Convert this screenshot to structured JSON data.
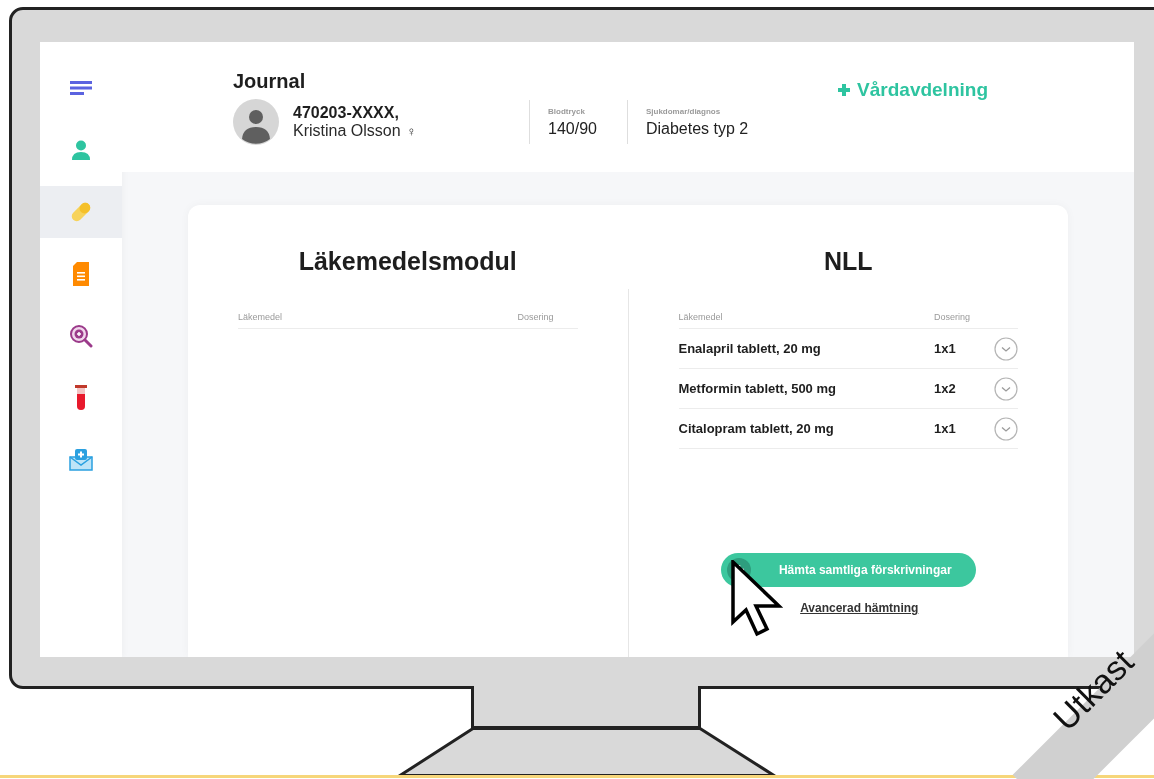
{
  "sidebar": {
    "items": [
      {
        "kind": "menu",
        "selected": false
      },
      {
        "kind": "patient",
        "selected": false
      },
      {
        "kind": "medication",
        "selected": true
      },
      {
        "kind": "document",
        "selected": false
      },
      {
        "kind": "search",
        "selected": false
      },
      {
        "kind": "lab",
        "selected": false
      },
      {
        "kind": "message",
        "selected": false
      }
    ]
  },
  "header": {
    "title": "Journal",
    "patient": {
      "id": "470203-XXXX,",
      "name": "Kristina Olsson",
      "sex_symbol": "♀"
    },
    "vitals": [
      {
        "label": "Blodtryck",
        "value": "140/90"
      },
      {
        "label": "Sjukdomar/diagnos",
        "value": "Diabetes typ 2"
      }
    ],
    "ward_button": "Vårdavdelning"
  },
  "panels": [
    {
      "title": "Läkemedelsmodul",
      "columns": [
        "Läkemedel",
        "Dosering"
      ]
    },
    {
      "title": "NLL",
      "columns": [
        "Läkemedel",
        "Dosering"
      ],
      "rows": [
        {
          "drug": "Enalapril tablett, 20 mg",
          "dose": "1x1"
        },
        {
          "drug": "Metformin tablett, 500 mg",
          "dose": "1x2"
        },
        {
          "drug": "Citalopram tablett, 20 mg",
          "dose": "1x1"
        }
      ]
    }
  ],
  "fetch_button": "Hämta samtliga förskrivningar",
  "advanced_link": "Avancerad hämtning",
  "draft_ribbon": "Utkast"
}
